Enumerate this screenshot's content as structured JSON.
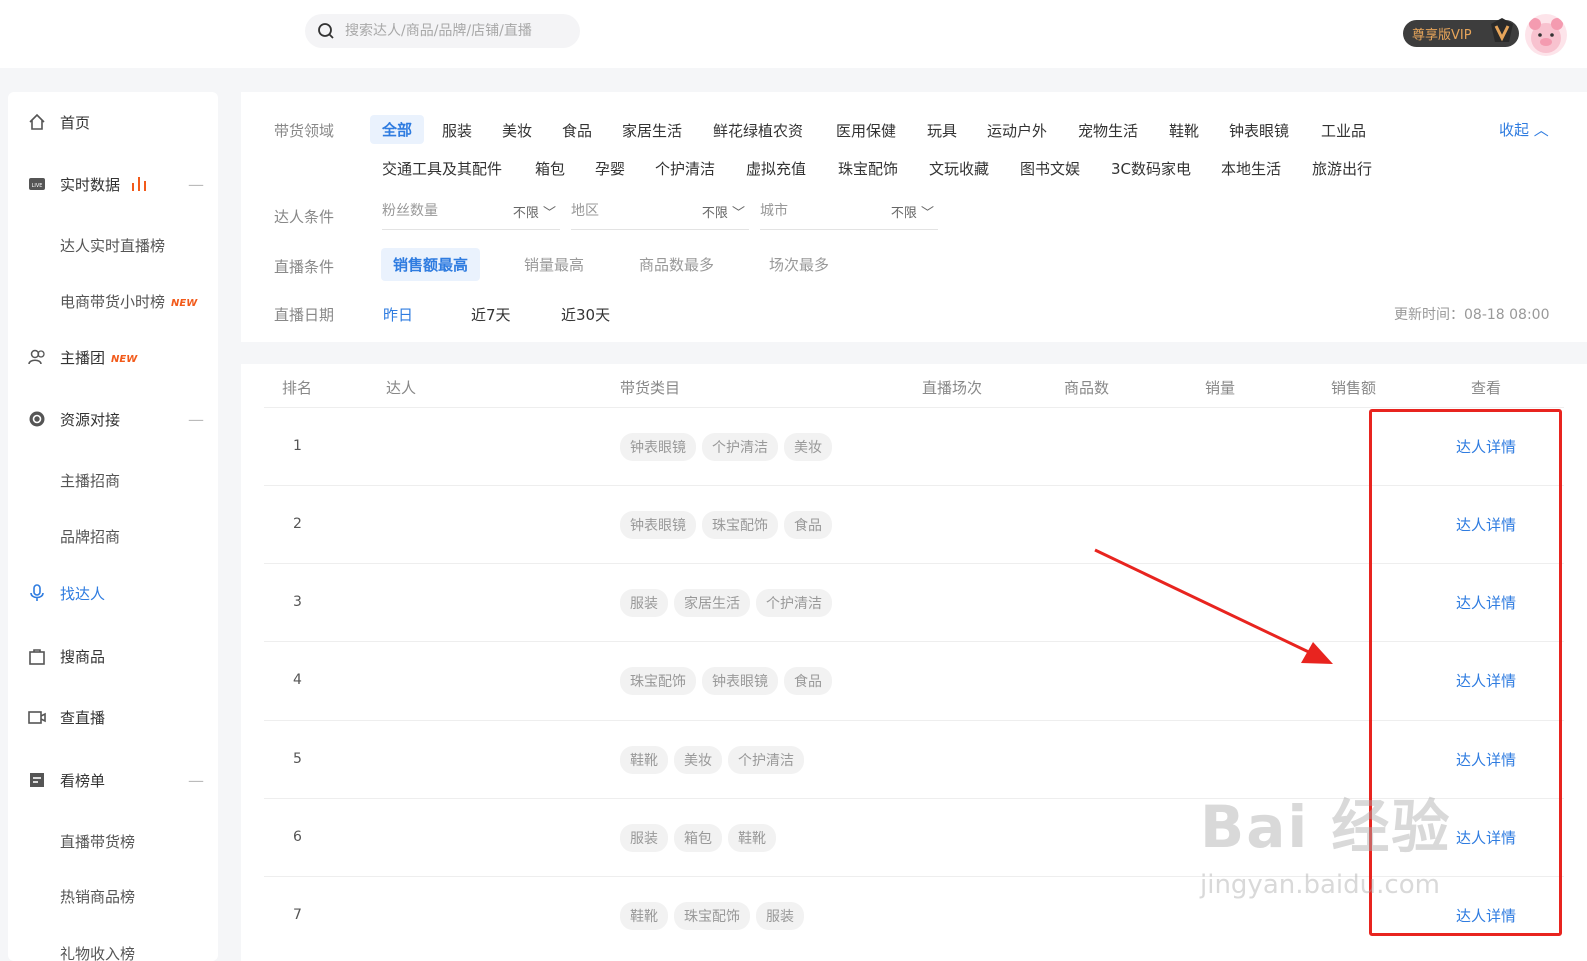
{
  "search": {
    "placeholder": "搜索达人/商品/品牌/店铺/直播"
  },
  "header": {
    "vip_label": "尊享版VIP"
  },
  "sidebar": {
    "home": "首页",
    "realtime": "实时数据",
    "realtime_live_rank": "达人实时直播榜",
    "ecom_hour_rank": "电商带货小时榜",
    "new_badge": "NEW",
    "anchor_group": "主播团",
    "resource": "资源对接",
    "anchor_recruit": "主播招商",
    "brand_recruit": "品牌招商",
    "find_talent": "找达人",
    "search_goods": "搜商品",
    "check_live": "查直播",
    "rankings": "看榜单",
    "live_sales_rank": "直播带货榜",
    "hot_goods_rank": "热销商品榜",
    "next_item": "礼物收入榜"
  },
  "filter": {
    "domain_label": "带货领域",
    "categories_row1": [
      "全部",
      "服装",
      "美妆",
      "食品",
      "家居生活",
      "鲜花绿植农资",
      "医用保健",
      "玩具",
      "运动户外",
      "宠物生活",
      "鞋靴",
      "钟表眼镜",
      "工业品"
    ],
    "categories_row2": [
      "交通工具及其配件",
      "箱包",
      "孕婴",
      "个护清洁",
      "虚拟充值",
      "珠宝配饰",
      "文玩收藏",
      "图书文娱",
      "3C数码家电",
      "本地生活",
      "旅游出行"
    ],
    "collapse": "收起 ︿",
    "talent_label": "达人条件",
    "fans": "粉丝数量",
    "region": "地区",
    "city": "城市",
    "unlimited": "不限 ﹀",
    "live_label": "直播条件",
    "sort_options": [
      "销售额最高",
      "销量最高",
      "商品数最多",
      "场次最多"
    ],
    "date_label": "直播日期",
    "dates": [
      "昨日",
      "近7天",
      "近30天"
    ],
    "update_time": "更新时间：08-18 08:00"
  },
  "table": {
    "headers": [
      "排名",
      "达人",
      "带货类目",
      "直播场次",
      "商品数",
      "销量",
      "销售额",
      "查看"
    ],
    "detail_label": "达人详情",
    "rows": [
      {
        "rank": "1",
        "tags": [
          "钟表眼镜",
          "个护清洁",
          "美妆"
        ]
      },
      {
        "rank": "2",
        "tags": [
          "钟表眼镜",
          "珠宝配饰",
          "食品"
        ]
      },
      {
        "rank": "3",
        "tags": [
          "服装",
          "家居生活",
          "个护清洁"
        ]
      },
      {
        "rank": "4",
        "tags": [
          "珠宝配饰",
          "钟表眼镜",
          "食品"
        ]
      },
      {
        "rank": "5",
        "tags": [
          "鞋靴",
          "美妆",
          "个护清洁"
        ]
      },
      {
        "rank": "6",
        "tags": [
          "服装",
          "箱包",
          "鞋靴"
        ]
      },
      {
        "rank": "7",
        "tags": [
          "鞋靴",
          "珠宝配饰",
          "服装"
        ]
      }
    ]
  },
  "watermark": {
    "text": "Bai 经验",
    "url": "jingyan.baidu.com"
  },
  "colors": {
    "accent": "#2f7ce0",
    "highlight": "#e8241f",
    "new_badge": "#f25a1a"
  }
}
